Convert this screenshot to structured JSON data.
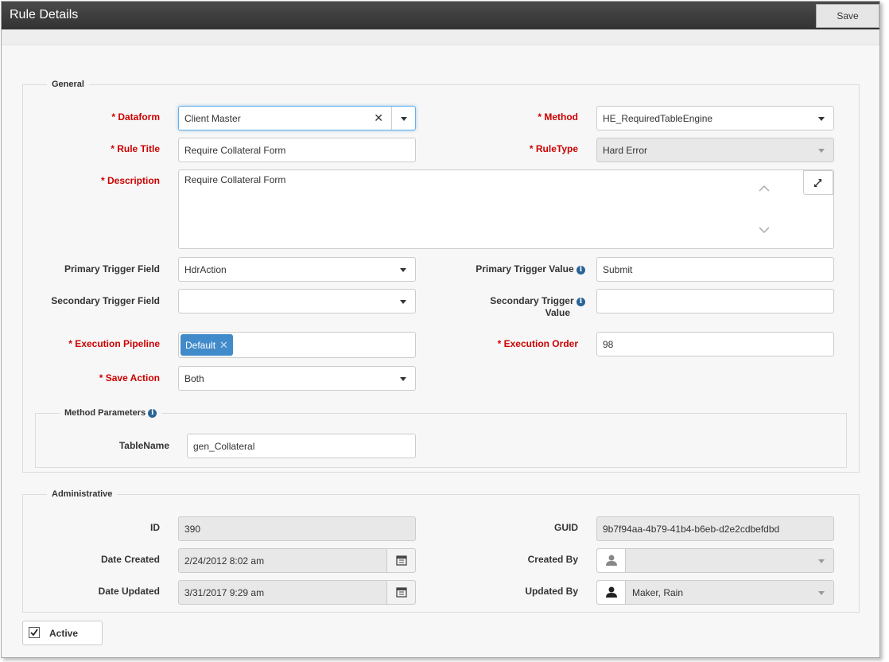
{
  "window": {
    "title": "Rule Details",
    "save_label": "Save"
  },
  "general": {
    "legend": "General",
    "dataform": {
      "label": "* Dataform",
      "value": "Client Master"
    },
    "method": {
      "label": "* Method",
      "value": "HE_RequiredTableEngine"
    },
    "rule_title": {
      "label": "* Rule Title",
      "value": "Require Collateral Form"
    },
    "rule_type": {
      "label": "* RuleType",
      "value": "Hard Error"
    },
    "description": {
      "label": "* Description",
      "value": "Require Collateral Form"
    },
    "primary_trigger_field": {
      "label": "Primary Trigger Field",
      "value": "HdrAction"
    },
    "primary_trigger_value": {
      "label": "Primary Trigger Value",
      "value": "Submit"
    },
    "secondary_trigger_field": {
      "label": "Secondary Trigger Field",
      "value": ""
    },
    "secondary_trigger_value": {
      "label_line1": "Secondary Trigger",
      "label_line2": "Value",
      "value": ""
    },
    "execution_pipeline": {
      "label": "* Execution Pipeline",
      "tag": "Default"
    },
    "execution_order": {
      "label": "* Execution Order",
      "value": "98"
    },
    "save_action": {
      "label": "* Save Action",
      "value": "Both"
    }
  },
  "method_parameters": {
    "legend": "Method Parameters",
    "table_name": {
      "label": "TableName",
      "value": "gen_Collateral"
    }
  },
  "administrative": {
    "legend": "Administrative",
    "id": {
      "label": "ID",
      "value": "390"
    },
    "guid": {
      "label": "GUID",
      "value": "9b7f94aa-4b79-41b4-b6eb-d2e2cdbefdbd"
    },
    "date_created": {
      "label": "Date Created",
      "value": "2/24/2012 8:02 am"
    },
    "created_by": {
      "label": "Created By",
      "value": ""
    },
    "date_updated": {
      "label": "Date Updated",
      "value": "3/31/2017 9:29 am"
    },
    "updated_by": {
      "label": "Updated By",
      "value": "Maker, Rain"
    }
  },
  "active": {
    "label": "Active",
    "checked": true
  },
  "icons": {
    "clear": "close-icon",
    "dropdown": "chevron-down-icon",
    "info": "info-icon",
    "expand": "expand-icon",
    "calendar": "calendar-icon",
    "user": "user-icon",
    "check": "checkmark-icon"
  },
  "colors": {
    "required": "#cc0000",
    "tag": "#428bca",
    "titlebar": "#3a3a3a"
  }
}
